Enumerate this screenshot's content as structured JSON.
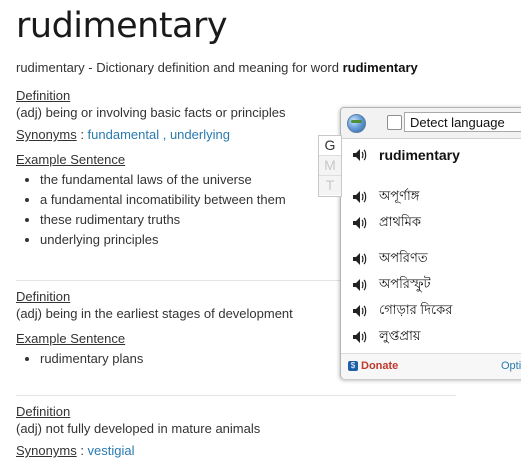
{
  "title": "rudimentary",
  "subtitle": {
    "prefix": "rudimentary - Dictionary definition and meaning for word ",
    "word": "rudimentary"
  },
  "definitions": [
    {
      "definition_label": "Definition",
      "text": "(adj) being or involving basic facts or principles",
      "synonyms_label": "Synonyms",
      "synonyms_sep": " : ",
      "synonyms": [
        "fundamental",
        "underlying"
      ],
      "synonym_joiner": " , ",
      "example_label": "Example Sentence",
      "examples": [
        "the fundamental laws of the universe",
        "a fundamental incomatibility between them",
        "these rudimentary truths",
        "underlying principles"
      ]
    },
    {
      "definition_label": "Definition",
      "text": "(adj) being in the earliest stages of development",
      "example_label": "Example Sentence",
      "examples": [
        "rudimentary plans"
      ]
    },
    {
      "definition_label": "Definition",
      "text": "(adj) not fully developed in mature animals",
      "synonyms_label": "Synonyms",
      "synonyms_sep": " : ",
      "synonyms": [
        "vestigial"
      ]
    }
  ],
  "popup": {
    "language_select": "Detect language",
    "detect_checked": false,
    "tabs": [
      "G",
      "M",
      "T"
    ],
    "source_word": "rudimentary",
    "translations": [
      "অপূর্ণাঙ্গ",
      "প্রাথমিক",
      "অপরিণত",
      "অপরিস্ফুট",
      "গোড়ার দিকের",
      "লুপ্তপ্রায়"
    ],
    "donate_label": "Donate",
    "options_label": "Opti"
  },
  "colors": {
    "link": "#2a7ab0",
    "donate": "#c0392b",
    "text": "#333333"
  },
  "icons": [
    "globe-icon",
    "speaker-icon",
    "checkbox",
    "donate-icon"
  ]
}
